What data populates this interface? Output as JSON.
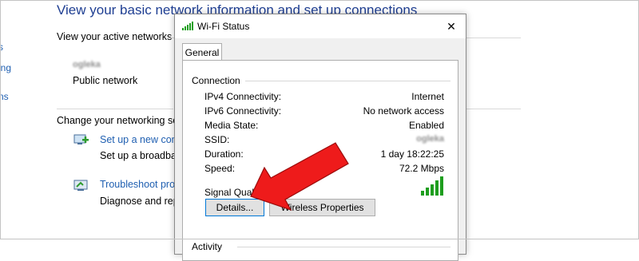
{
  "control_panel": {
    "heading": "View your basic network information and set up connections",
    "left_nav": [
      "s",
      "ing",
      "ns"
    ],
    "active_networks_heading": "View your active networks",
    "network_name": "ogleka",
    "network_type": "Public network",
    "change_settings_heading": "Change your networking set",
    "setup_link": "Set up a new conn",
    "setup_desc": "Set up a broadban",
    "troubleshoot_link": "Troubleshoot prob",
    "troubleshoot_desc": "Diagnose and rep"
  },
  "dialog": {
    "title": "Wi-Fi Status",
    "close_glyph": "✕",
    "tab_general": "General",
    "connection_group": "Connection",
    "rows": [
      {
        "label": "IPv4 Connectivity:",
        "value": "Internet"
      },
      {
        "label": "IPv6 Connectivity:",
        "value": "No network access"
      },
      {
        "label": "Media State:",
        "value": "Enabled"
      },
      {
        "label": "SSID:",
        "value": "ogleka"
      },
      {
        "label": "Duration:",
        "value": "1 day 18:22:25"
      },
      {
        "label": "Speed:",
        "value": "72.2 Mbps"
      }
    ],
    "signal_quality_label": "Signal Quality:",
    "signal_bars": 5,
    "details_button": "Details...",
    "wireless_properties_button": "Wireless Properties",
    "activity_group": "Activity"
  },
  "colors": {
    "signal_green": "#1e9e1e",
    "arrow_red": "#ee1b1b",
    "link_blue": "#1f5fb1"
  },
  "icons": {
    "title_icon": "wifi-signal-icon",
    "setup_icon": "network-setup-icon",
    "troubleshoot_icon": "troubleshoot-icon",
    "annotation": "red-arrow"
  }
}
